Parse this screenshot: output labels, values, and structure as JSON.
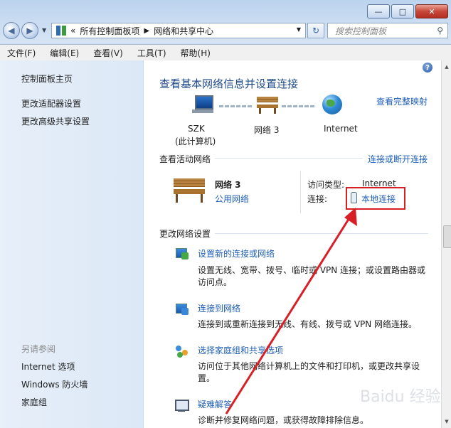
{
  "window": {
    "min_glyph": "—",
    "max_glyph": "□",
    "close_glyph": "✕"
  },
  "nav": {
    "back_glyph": "◀",
    "forward_glyph": "▶",
    "breadcrumb_prefix": "«",
    "breadcrumb": [
      "所有控制面板项",
      "网络和共享中心"
    ],
    "breadcrumb_sep": "▶",
    "search_placeholder": "搜索控制面板"
  },
  "menu": [
    "文件(F)",
    "编辑(E)",
    "查看(V)",
    "工具(T)",
    "帮助(H)"
  ],
  "sidebar": {
    "links": [
      "控制面板主页",
      "更改适配器设置",
      "更改高级共享设置"
    ],
    "see_also_title": "另请参阅",
    "see_also": [
      "Internet 选项",
      "Windows 防火墙",
      "家庭组"
    ]
  },
  "main": {
    "title": "查看基本网络信息并设置连接",
    "full_map_link": "查看完整映射",
    "map": {
      "computer_name": "SZK",
      "computer_sub": "(此计算机)",
      "network_name": "网络  3",
      "internet": "Internet"
    },
    "active_header": "查看活动网络",
    "connect_disconnect": "连接或断开连接",
    "active": {
      "network_name": "网络  3",
      "network_type": "公用网络",
      "access_label": "访问类型:",
      "access_value": "Internet",
      "conn_label": "连接:",
      "conn_value": "本地连接"
    },
    "change_header": "更改网络设置",
    "tasks": [
      {
        "title": "设置新的连接或网络",
        "desc1": "设置无线、宽带、拨号、临时或 VPN 连接；或设置路由器或",
        "desc2": "访问点。"
      },
      {
        "title": "连接到网络",
        "desc1": "连接到或重新连接到无线、有线、拨号或 VPN 网络连接。",
        "desc2": ""
      },
      {
        "title": "选择家庭组和共享选项",
        "desc1": "访问位于其他网络计算机上的文件和打印机，或更改共享设",
        "desc2": "置。"
      },
      {
        "title": "疑难解答",
        "desc1": "诊断并修复网络问题，或获得故障排除信息。",
        "desc2": ""
      }
    ]
  },
  "help_glyph": "?",
  "watermark": "Baidu 经验",
  "colors": {
    "link": "#1e5fb8",
    "title": "#1e4a8a",
    "annotation": "#d81f26"
  }
}
